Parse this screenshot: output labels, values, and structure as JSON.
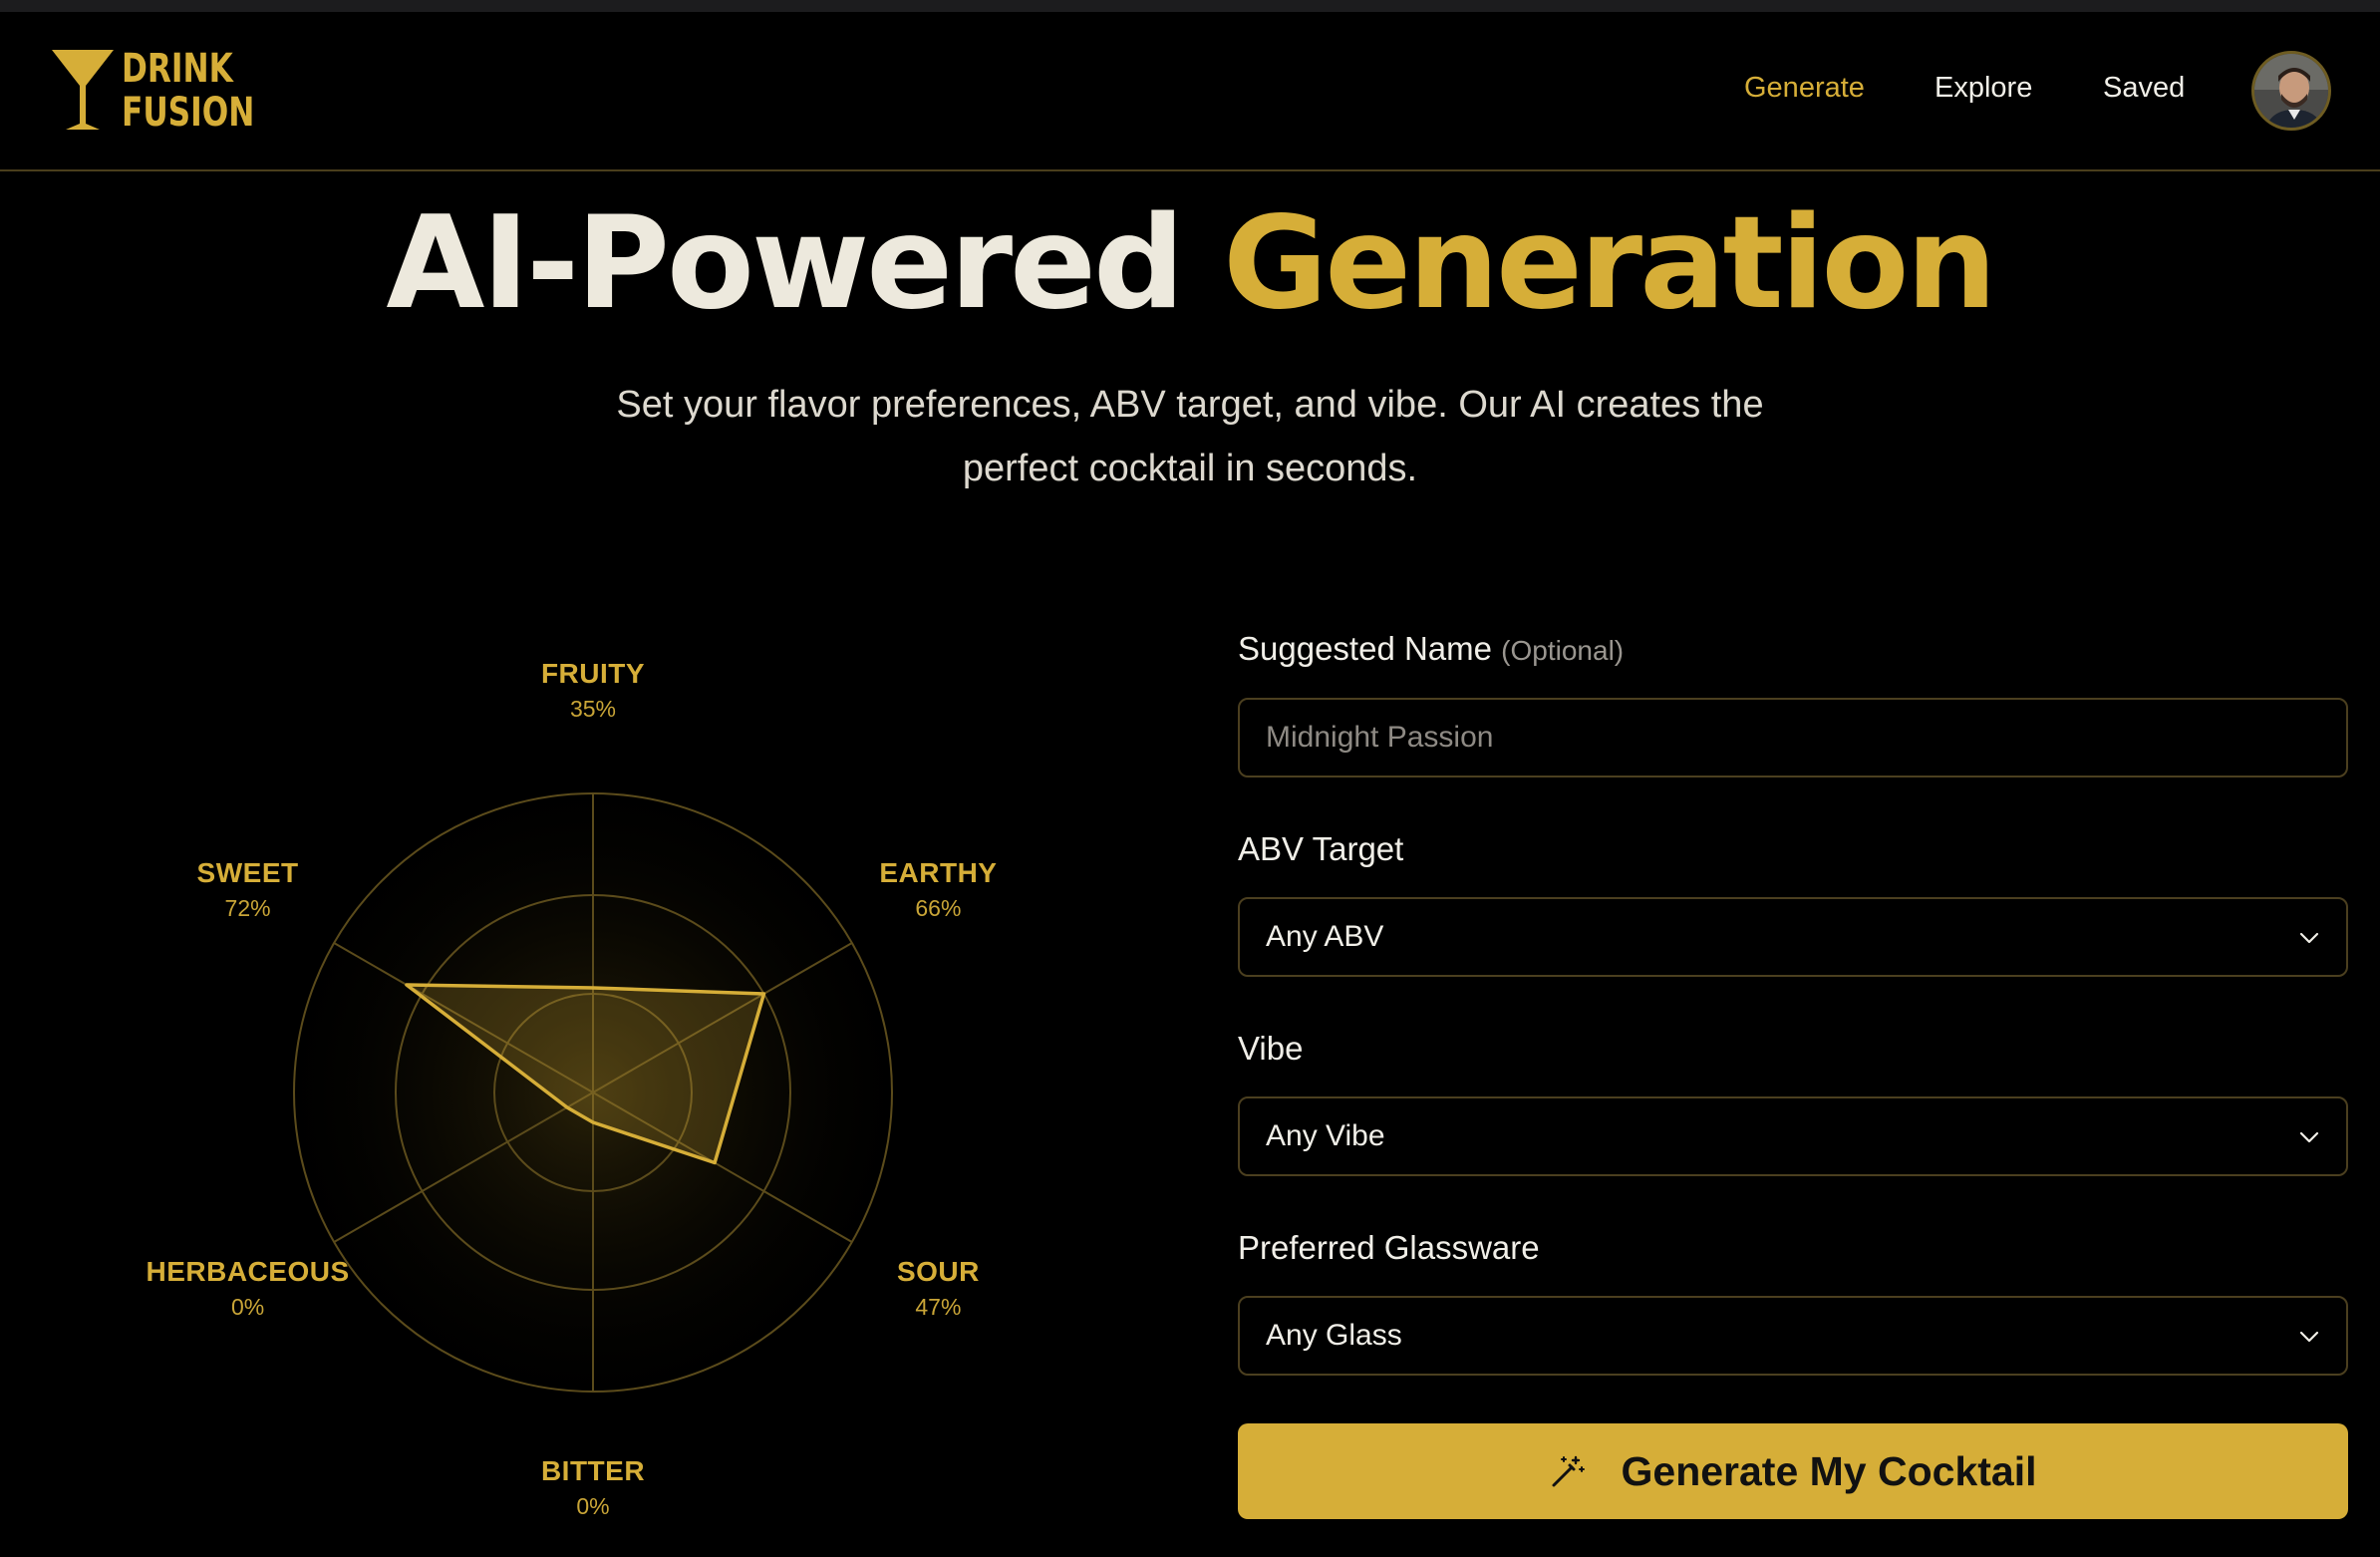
{
  "brand": {
    "name_line1": "DRINK",
    "name_line2": "FUSION",
    "accent": "#d6ae38"
  },
  "nav": {
    "items": [
      {
        "label": "Generate",
        "active": true
      },
      {
        "label": "Explore",
        "active": false
      },
      {
        "label": "Saved",
        "active": false
      }
    ],
    "avatar_icon": "user-avatar"
  },
  "hero": {
    "title_part1": "AI-Powered",
    "title_part2": "Generation",
    "subtitle_line1": "Set your flavor preferences, ABV target, and vibe. Our AI creates the",
    "subtitle_line2": "perfect cocktail in seconds."
  },
  "flavor_profile": {
    "axes": [
      {
        "name": "FRUITY",
        "value": 35,
        "pct_label": "35%"
      },
      {
        "name": "EARTHY",
        "value": 66,
        "pct_label": "66%"
      },
      {
        "name": "SOUR",
        "value": 47,
        "pct_label": "47%"
      },
      {
        "name": "BITTER",
        "value": 0,
        "pct_label": "0%"
      },
      {
        "name": "HERBACEOUS",
        "value": 0,
        "pct_label": "0%"
      },
      {
        "name": "SWEET",
        "value": 72,
        "pct_label": "72%"
      }
    ]
  },
  "form": {
    "name_label": "Suggested Name",
    "name_optional": "(Optional)",
    "name_placeholder": "Midnight Passion",
    "abv_label": "ABV Target",
    "abv_value": "Any ABV",
    "vibe_label": "Vibe",
    "vibe_value": "Any Vibe",
    "glass_label": "Preferred Glassware",
    "glass_value": "Any Glass",
    "submit_label": "Generate My Cocktail",
    "submit_icon": "magic-wand-icon"
  }
}
